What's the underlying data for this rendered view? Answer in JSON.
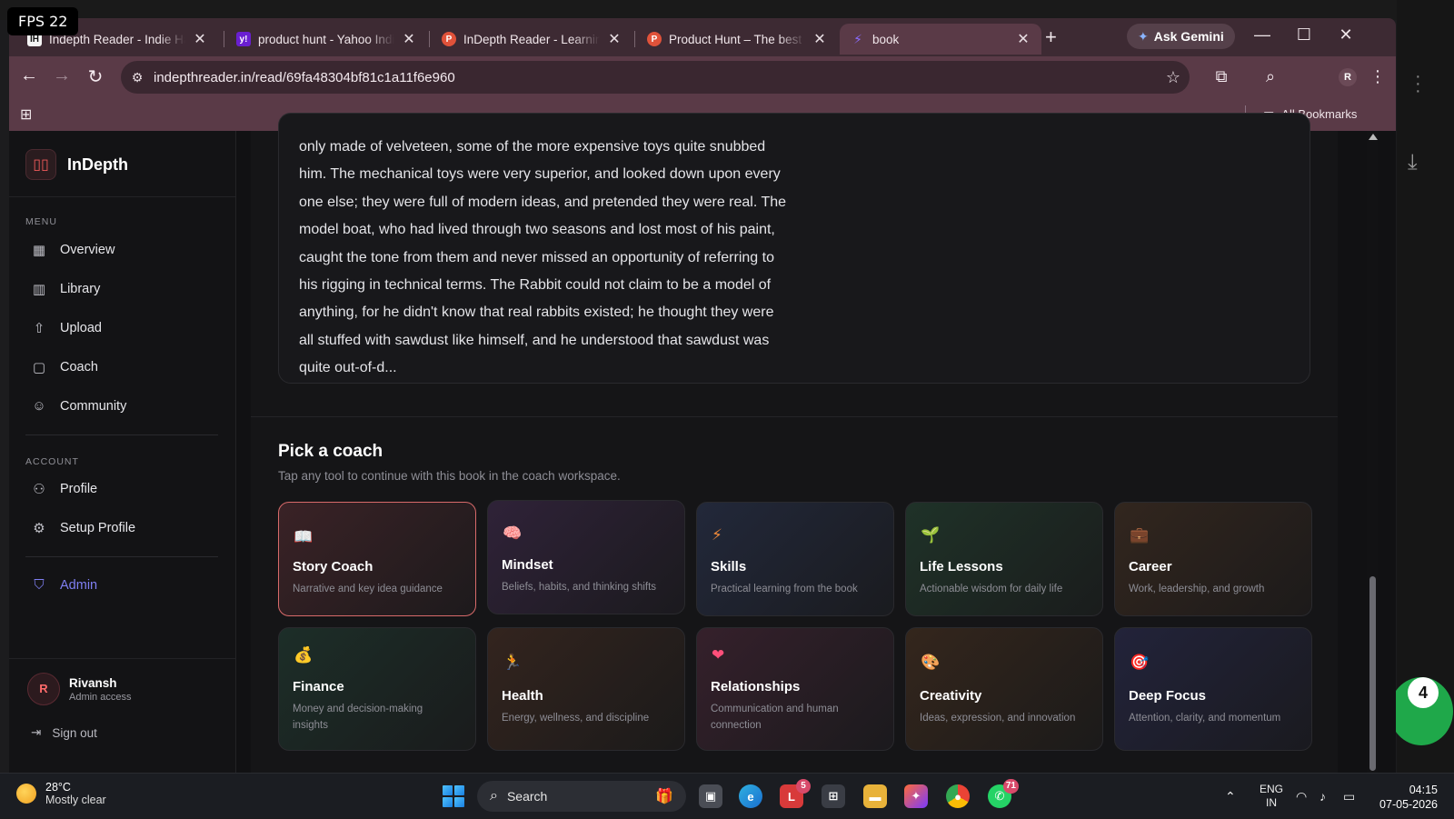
{
  "overlay": {
    "fps": "FPS 22"
  },
  "browser": {
    "tabs": [
      {
        "title": "Indepth Reader - Indie Hack",
        "fav": "IH",
        "fav_color": "#f5f5f5"
      },
      {
        "title": "product hunt - Yahoo India S",
        "fav": "y!",
        "fav_color": "#6a1fd1"
      },
      {
        "title": "InDepth Reader - Learning n",
        "fav": "P",
        "fav_color": "#e0523a"
      },
      {
        "title": "Product Hunt – The best new",
        "fav": "P",
        "fav_color": "#e0523a"
      },
      {
        "title": "book",
        "fav": "⚡",
        "fav_color": "#7a5cff"
      }
    ],
    "gemini_label": "Ask Gemini",
    "url": "indepthreader.in/read/69fa48304bf81c1a11f6e960",
    "profile_initial": "R",
    "all_bookmarks": "All Bookmarks"
  },
  "sidebar": {
    "brand": "InDepth",
    "menu_label": "MENU",
    "menu": [
      {
        "label": "Overview",
        "icon": "grid-icon"
      },
      {
        "label": "Library",
        "icon": "book-icon"
      },
      {
        "label": "Upload",
        "icon": "upload-icon"
      },
      {
        "label": "Coach",
        "icon": "chat-icon"
      },
      {
        "label": "Community",
        "icon": "users-icon"
      }
    ],
    "account_label": "ACCOUNT",
    "account": [
      {
        "label": "Profile",
        "icon": "user-icon"
      },
      {
        "label": "Setup Profile",
        "icon": "gear-icon"
      }
    ],
    "admin": "Admin",
    "user": {
      "initial": "R",
      "name": "Rivansh",
      "role": "Admin access"
    },
    "signout": "Sign out"
  },
  "excerpt": "only made of velveteen, some of the more expensive toys quite snubbed him. The mechanical toys were very superior, and looked down upon every one else; they were full of modern ideas, and pretended they were real. The model boat, who had lived through two seasons and lost most of his paint, caught the tone from them and never missed an opportunity of referring to his rigging in technical terms. The Rabbit could not claim to be a model of anything, for he didn't know that real rabbits existed; he thought they were all stuffed with sawdust like himself, and he understood that sawdust was quite out-of-d...",
  "coach": {
    "title": "Pick a coach",
    "subtitle": "Tap any tool to continue with this book in the coach workspace.",
    "cards": [
      {
        "name": "Story Coach",
        "desc": "Narrative and key idea guidance",
        "icon": "📖",
        "selected": true
      },
      {
        "name": "Mindset",
        "desc": "Beliefs, habits, and thinking shifts",
        "icon": "🧠"
      },
      {
        "name": "Skills",
        "desc": "Practical learning from the book",
        "icon": "⚡"
      },
      {
        "name": "Life Lessons",
        "desc": "Actionable wisdom for daily life",
        "icon": "🌱"
      },
      {
        "name": "Career",
        "desc": "Work, leadership, and growth",
        "icon": "💼"
      },
      {
        "name": "Finance",
        "desc": "Money and decision-making insights",
        "icon": "💰"
      },
      {
        "name": "Health",
        "desc": "Energy, wellness, and discipline",
        "icon": "🏃"
      },
      {
        "name": "Relationships",
        "desc": "Communication and human connection",
        "icon": "❤"
      },
      {
        "name": "Creativity",
        "desc": "Ideas, expression, and innovation",
        "icon": "🎨"
      },
      {
        "name": "Deep Focus",
        "desc": "Attention, clarity, and momentum",
        "icon": "🎯"
      }
    ]
  },
  "desktop": {
    "notification_count": "4"
  },
  "taskbar": {
    "weather_temp": "28°C",
    "weather_desc": "Mostly clear",
    "search": "Search",
    "lang1": "ENG",
    "lang2": "IN",
    "time": "04:15",
    "date": "07-05-2026",
    "badge_l": "5",
    "badge_wa": "71"
  }
}
